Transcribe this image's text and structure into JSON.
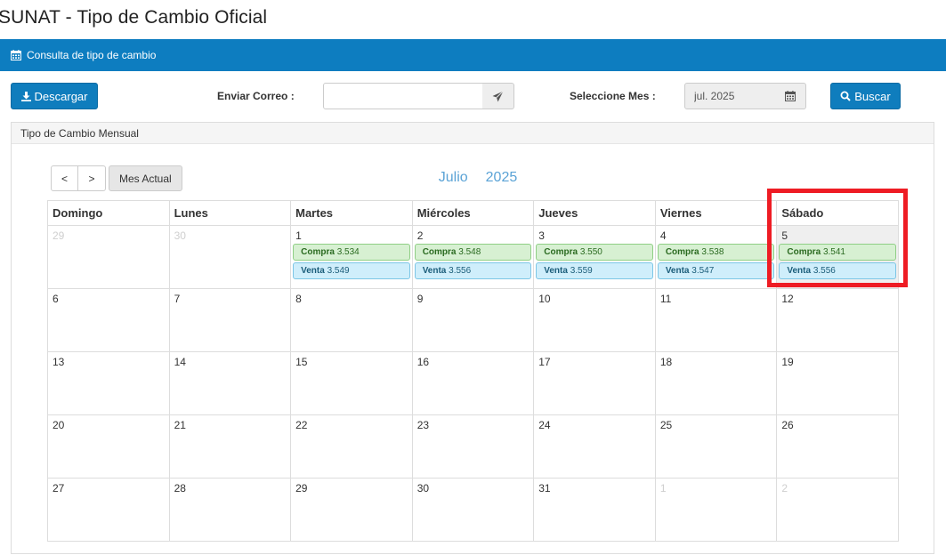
{
  "page_title": "SUNAT - Tipo de Cambio Oficial",
  "panel": {
    "title": "Consulta de tipo de cambio",
    "icon": "calendar-icon"
  },
  "toolbar": {
    "download_label": "Descargar",
    "email_label": "Enviar Correo :",
    "email_value": "",
    "month_label": "Seleccione Mes :",
    "month_value": "jul. 2025",
    "search_label": "Buscar"
  },
  "calendar": {
    "section_title": "Tipo de Cambio Mensual",
    "prev_label": "<",
    "next_label": ">",
    "today_label": "Mes Actual",
    "month": "Julio",
    "year": "2025",
    "weekdays": [
      "Domingo",
      "Lunes",
      "Martes",
      "Miércoles",
      "Jueves",
      "Viernes",
      "Sábado"
    ],
    "compra_label": "Compra",
    "venta_label": "Venta",
    "weeks": [
      [
        {
          "day": "29",
          "other": true
        },
        {
          "day": "30",
          "other": true
        },
        {
          "day": "1",
          "compra": "3.534",
          "venta": "3.549"
        },
        {
          "day": "2",
          "compra": "3.548",
          "venta": "3.556"
        },
        {
          "day": "3",
          "compra": "3.550",
          "venta": "3.559"
        },
        {
          "day": "4",
          "compra": "3.538",
          "venta": "3.547"
        },
        {
          "day": "5",
          "compra": "3.541",
          "venta": "3.556",
          "highlight": true
        }
      ],
      [
        {
          "day": "6"
        },
        {
          "day": "7"
        },
        {
          "day": "8"
        },
        {
          "day": "9"
        },
        {
          "day": "10"
        },
        {
          "day": "11"
        },
        {
          "day": "12"
        }
      ],
      [
        {
          "day": "13"
        },
        {
          "day": "14"
        },
        {
          "day": "15"
        },
        {
          "day": "16"
        },
        {
          "day": "17"
        },
        {
          "day": "18"
        },
        {
          "day": "19"
        }
      ],
      [
        {
          "day": "20"
        },
        {
          "day": "21"
        },
        {
          "day": "22"
        },
        {
          "day": "23"
        },
        {
          "day": "24"
        },
        {
          "day": "25"
        },
        {
          "day": "26"
        }
      ],
      [
        {
          "day": "27"
        },
        {
          "day": "28"
        },
        {
          "day": "29"
        },
        {
          "day": "30"
        },
        {
          "day": "31"
        },
        {
          "day": "1",
          "other": true
        },
        {
          "day": "2",
          "other": true
        }
      ]
    ]
  },
  "colors": {
    "header_blue": "#0d7dc0",
    "button_blue": "#0f7dbd",
    "month_title": "#5ba3d6",
    "compra_bg": "#d7f0d2",
    "venta_bg": "#cfeefb",
    "annotation_red": "#ee1c24"
  }
}
